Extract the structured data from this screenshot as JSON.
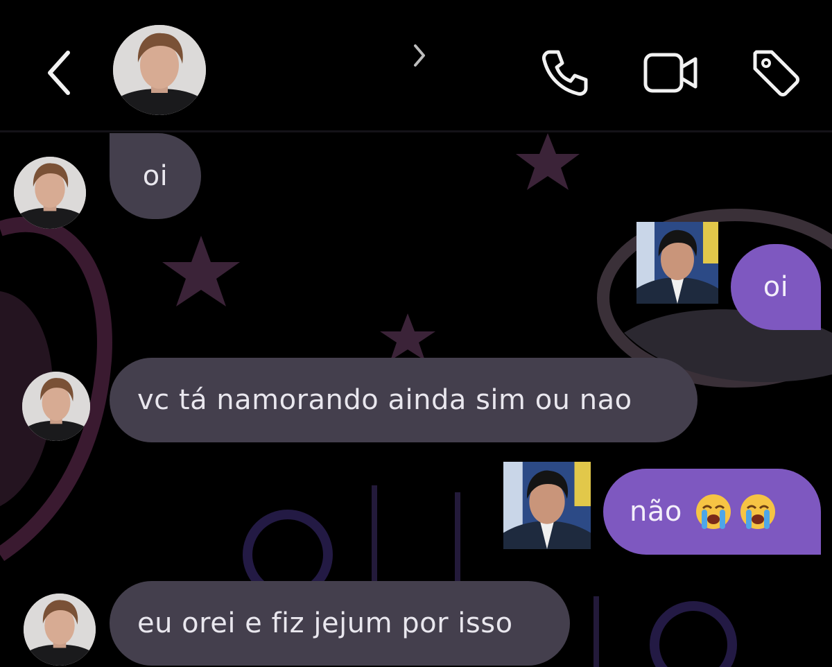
{
  "header": {
    "back_icon": "chevron-left-icon",
    "contact_avatar": "contact-avatar",
    "expand_icon": "chevron-right-icon",
    "actions": [
      {
        "icon": "phone-icon"
      },
      {
        "icon": "video-camera-icon"
      },
      {
        "icon": "tag-icon"
      }
    ]
  },
  "messages": [
    {
      "from": "contact",
      "text": "oi"
    },
    {
      "from": "me",
      "text": "oi"
    },
    {
      "from": "contact",
      "text": "vc tá namorando ainda sim ou nao"
    },
    {
      "from": "me",
      "text": "não",
      "emojis": [
        "loudly-crying-face",
        "loudly-crying-face"
      ]
    },
    {
      "from": "contact",
      "text": "eu orei e fiz jejum por isso"
    }
  ],
  "colors": {
    "background": "#000000",
    "incoming_bubble": "#443f4d",
    "outgoing_bubble": "#7e58c0",
    "background_art": "#3a1f33"
  }
}
